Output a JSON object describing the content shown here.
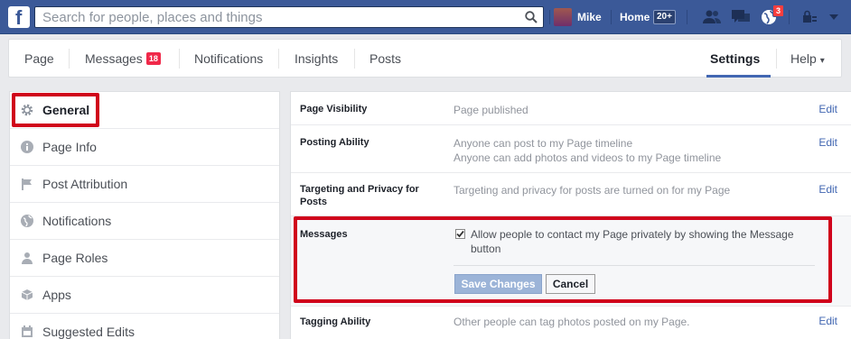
{
  "topbar": {
    "logo": "f",
    "search_placeholder": "Search for people, places and things",
    "user_name": "Mike",
    "home_label": "Home",
    "home_badge": "20+",
    "notifications_count": "3",
    "brand_color": "#3b5998"
  },
  "pagenav": {
    "tabs": [
      {
        "label": "Page"
      },
      {
        "label": "Messages",
        "badge": "18"
      },
      {
        "label": "Notifications"
      },
      {
        "label": "Insights"
      },
      {
        "label": "Posts"
      }
    ],
    "settings_label": "Settings",
    "help_label": "Help",
    "help_caret": "▾",
    "active_tab": "Settings"
  },
  "sidebar": {
    "items": [
      {
        "label": "General",
        "icon": "gear-icon",
        "active": true
      },
      {
        "label": "Page Info",
        "icon": "info-icon"
      },
      {
        "label": "Post Attribution",
        "icon": "flag-icon"
      },
      {
        "label": "Notifications",
        "icon": "globe-icon"
      },
      {
        "label": "Page Roles",
        "icon": "person-icon"
      },
      {
        "label": "Apps",
        "icon": "cube-icon"
      },
      {
        "label": "Suggested Edits",
        "icon": "calendar-icon"
      }
    ]
  },
  "settings": {
    "rows": [
      {
        "label": "Page Visibility",
        "value": "Page published",
        "edit": "Edit"
      },
      {
        "label": "Posting Ability",
        "value_lines": [
          "Anyone can post to my Page timeline",
          "Anyone can add photos and videos to my Page timeline"
        ],
        "edit": "Edit"
      },
      {
        "label": "Targeting and Privacy for Posts",
        "value": "Targeting and privacy for posts are turned on for my Page",
        "edit": "Edit"
      },
      {
        "label": "Tagging Ability",
        "value": "Other people can tag photos posted on my Page.",
        "edit": "Edit"
      }
    ],
    "messages": {
      "label": "Messages",
      "checkbox_label": "Allow people to contact my Page privately by showing the Message button",
      "checked": true,
      "save_label": "Save Changes",
      "cancel_label": "Cancel"
    }
  },
  "highlight_color": "#d0021b"
}
